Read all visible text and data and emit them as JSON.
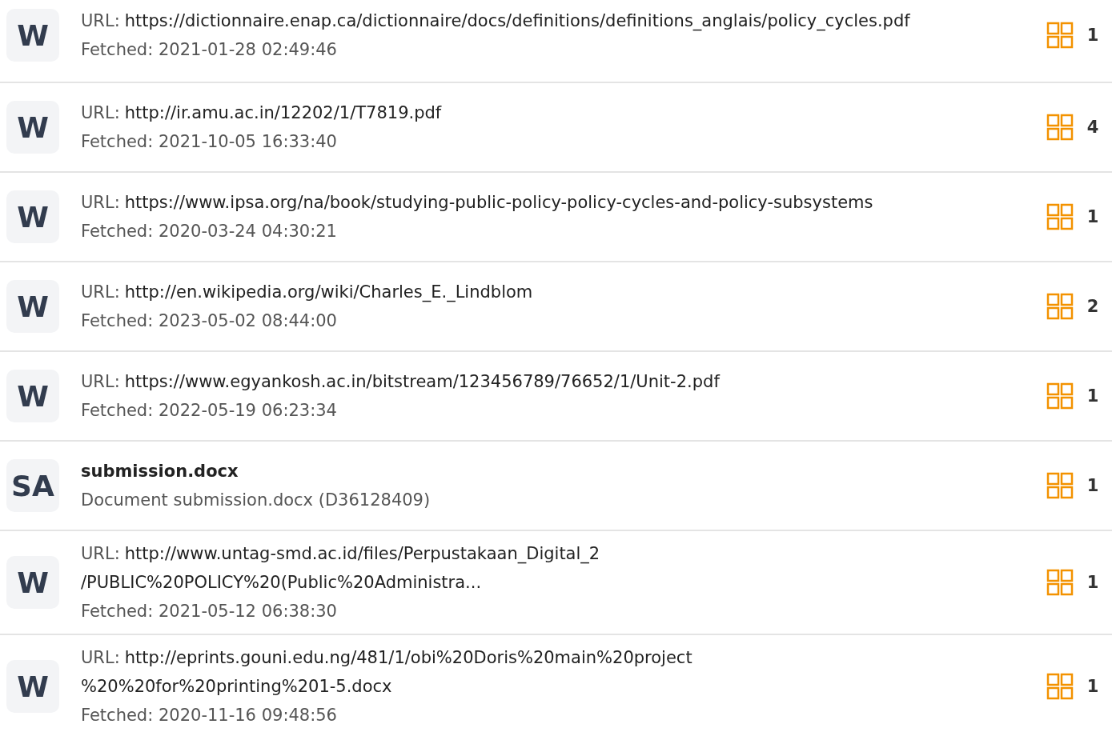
{
  "sources": [
    {
      "kind": "url",
      "badge": "W",
      "label": "URL:",
      "lines": [
        "https://dictionnaire.enap.ca/dictionnaire/docs/definitions/definitions_anglais/policy_cycles.pdf"
      ],
      "fetched": "Fetched: 2021-01-28 02:49:46",
      "count": "1"
    },
    {
      "kind": "url",
      "badge": "W",
      "label": "URL:",
      "lines": [
        "http://ir.amu.ac.in/12202/1/T7819.pdf"
      ],
      "fetched": "Fetched: 2021-10-05 16:33:40",
      "count": "4"
    },
    {
      "kind": "url",
      "badge": "W",
      "label": "URL:",
      "lines": [
        "https://www.ipsa.org/na/book/studying-public-policy-policy-cycles-and-policy-subsystems"
      ],
      "fetched": "Fetched: 2020-03-24 04:30:21",
      "count": "1"
    },
    {
      "kind": "url",
      "badge": "W",
      "label": "URL:",
      "lines": [
        "http://en.wikipedia.org/wiki/Charles_E._Lindblom"
      ],
      "fetched": "Fetched: 2023-05-02 08:44:00",
      "count": "2"
    },
    {
      "kind": "url",
      "badge": "W",
      "label": "URL:",
      "lines": [
        "https://www.egyankosh.ac.in/bitstream/123456789/76652/1/Unit-2.pdf"
      ],
      "fetched": "Fetched: 2022-05-19 06:23:34",
      "count": "1"
    },
    {
      "kind": "file",
      "badge": "SA",
      "title": "submission.docx",
      "description": "Document submission.docx (D36128409)",
      "count": "1"
    },
    {
      "kind": "url",
      "badge": "W",
      "label": "URL:",
      "lines": [
        "http://www.untag-smd.ac.id/files/Perpustakaan_Digital_2",
        "/PUBLIC%20POLICY%20(Public%20Administra..."
      ],
      "fetched": "Fetched: 2021-05-12 06:38:30",
      "count": "1"
    },
    {
      "kind": "url",
      "badge": "W",
      "label": "URL:",
      "lines": [
        "http://eprints.gouni.edu.ng/481/1/obi%20Doris%20main%20project",
        "%20%20for%20printing%201-5.docx"
      ],
      "fetched": "Fetched: 2020-11-16 09:48:56",
      "count": "1"
    }
  ]
}
